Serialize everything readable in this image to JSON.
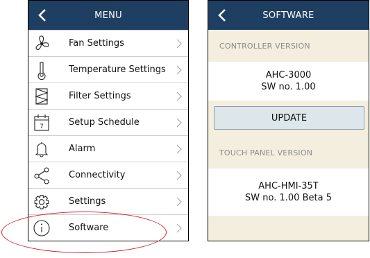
{
  "menu_screen": {
    "title": "MENU",
    "items": [
      {
        "label": "Fan Settings",
        "icon": "fan-icon"
      },
      {
        "label": "Temperature Settings",
        "icon": "thermometer-icon"
      },
      {
        "label": "Filter Settings",
        "icon": "filter-icon"
      },
      {
        "label": "Setup Schedule",
        "icon": "calendar-icon",
        "icon_text": "7"
      },
      {
        "label": "Alarm",
        "icon": "bell-icon"
      },
      {
        "label": "Connectivity",
        "icon": "share-icon"
      },
      {
        "label": "Settings",
        "icon": "gear-icon"
      },
      {
        "label": "Software",
        "icon": "info-icon"
      }
    ]
  },
  "software_screen": {
    "title": "SOFTWARE",
    "controller": {
      "heading": "CONTROLLER VERSION",
      "model": "AHC-3000",
      "sw": "SW no. 1.00"
    },
    "update_label": "UPDATE",
    "touch_panel": {
      "heading": "TOUCH PANEL VERSION",
      "model": "AHC-HMI-35T",
      "sw": "SW no. 1.00 Beta 5"
    }
  },
  "colors": {
    "header": "#1f3f62",
    "background_beige": "#f3eedd",
    "highlight": "#d6262b",
    "button_fill": "#dde6ea"
  }
}
